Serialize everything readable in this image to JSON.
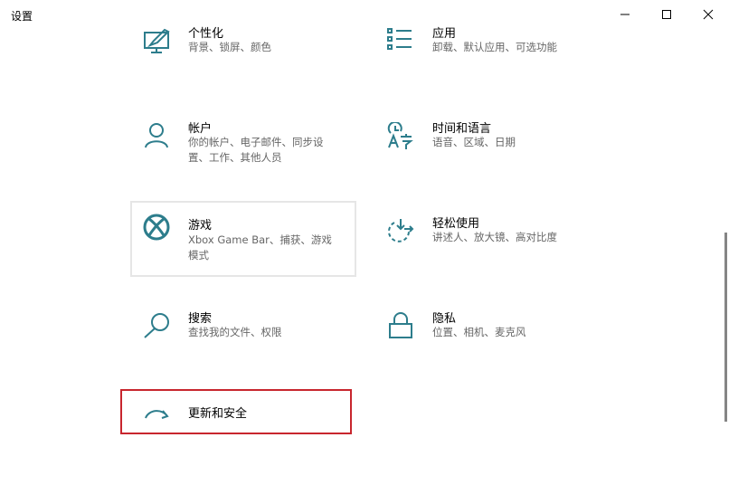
{
  "window": {
    "title": "设置"
  },
  "tiles": [
    {
      "title": "个性化",
      "subtitle": "背景、锁屏、颜色",
      "icon": "personalization-icon"
    },
    {
      "title": "应用",
      "subtitle": "卸载、默认应用、可选功能",
      "icon": "apps-icon"
    },
    {
      "title": "帐户",
      "subtitle": "你的帐户、电子邮件、同步设置、工作、其他人员",
      "icon": "account-icon"
    },
    {
      "title": "时间和语言",
      "subtitle": "语音、区域、日期",
      "icon": "time-language-icon"
    },
    {
      "title": "游戏",
      "subtitle": "Xbox Game Bar、捕获、游戏模式",
      "icon": "xbox-icon"
    },
    {
      "title": "轻松使用",
      "subtitle": "讲述人、放大镜、高对比度",
      "icon": "ease-of-access-icon"
    },
    {
      "title": "搜索",
      "subtitle": "查找我的文件、权限",
      "icon": "search-icon"
    },
    {
      "title": "隐私",
      "subtitle": "位置、相机、麦克风",
      "icon": "lock-icon"
    },
    {
      "title": "更新和安全",
      "subtitle": "",
      "icon": "update-icon"
    }
  ],
  "colors": {
    "accent": "#2d7d8c",
    "highlight": "#c8262e"
  }
}
